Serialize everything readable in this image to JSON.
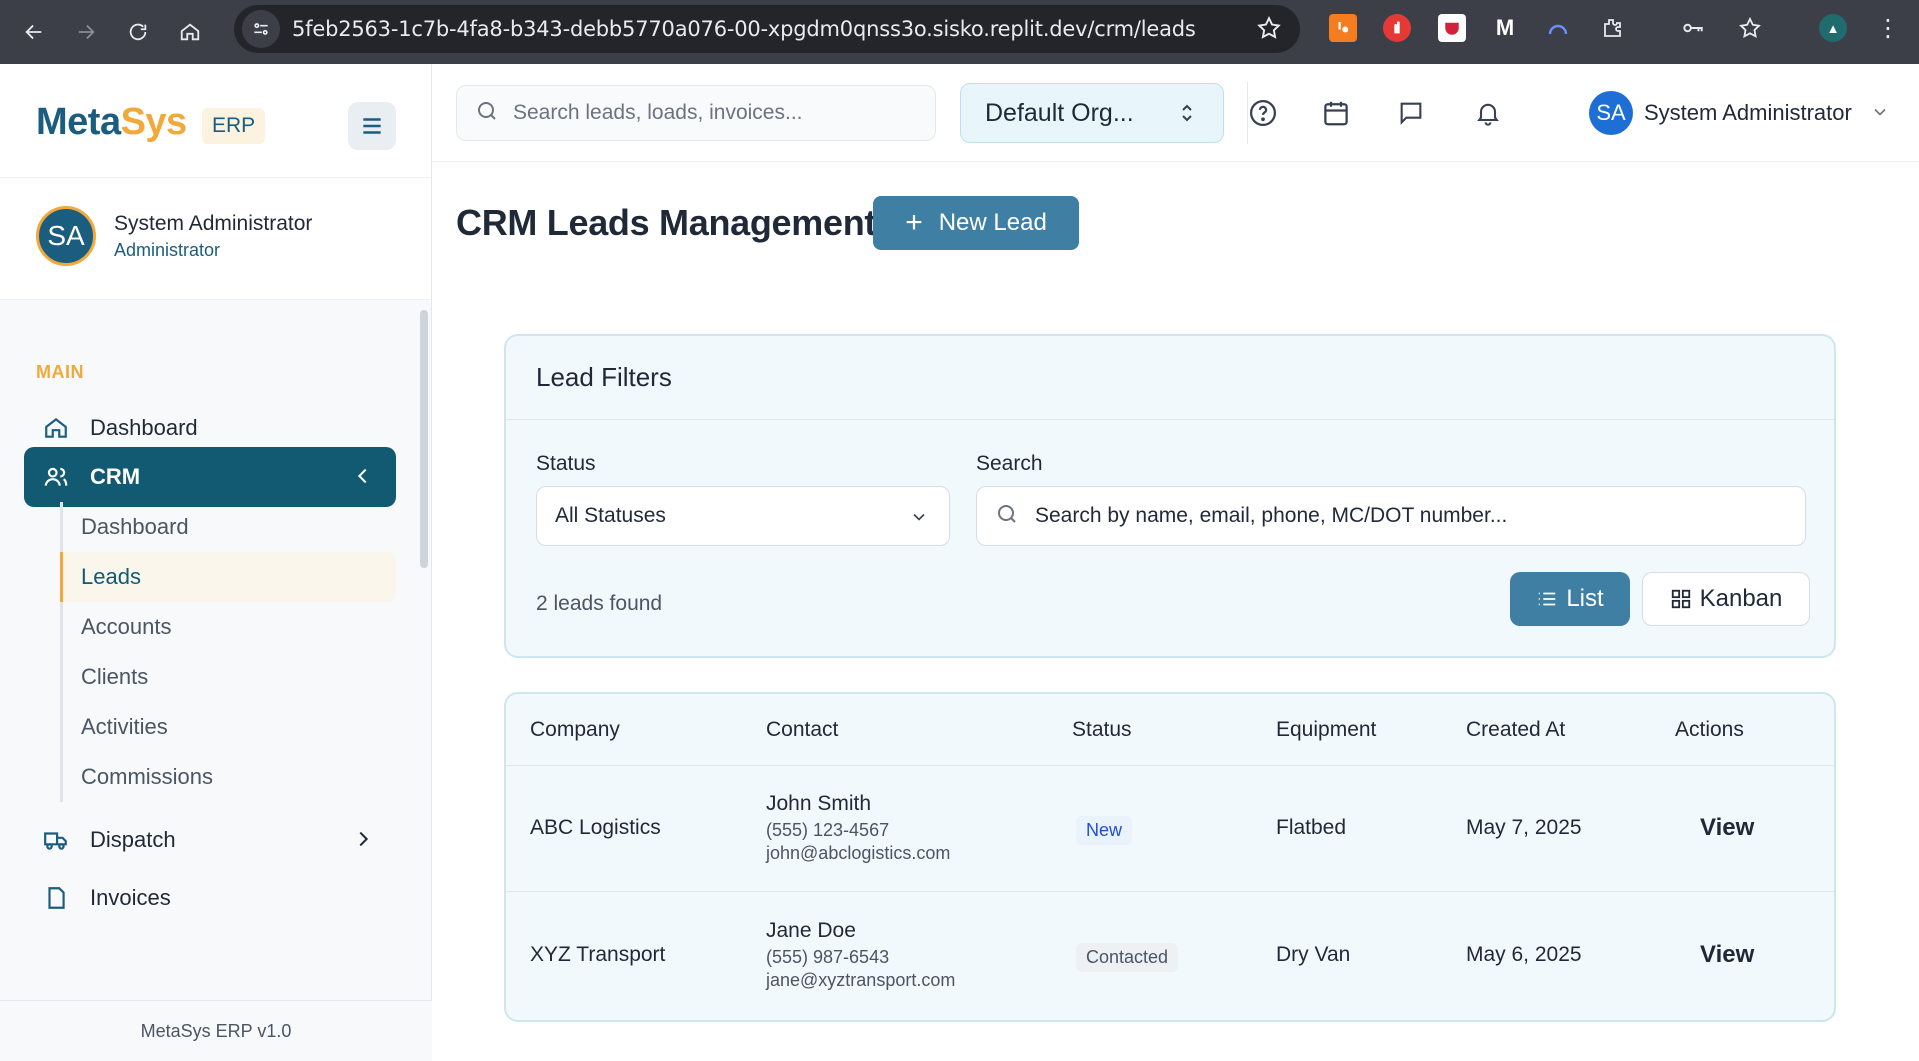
{
  "browser": {
    "url": "5feb2563-1c7b-4fa8-b343-debb5770a076-00-xpgdm0qnss3o.sisko.replit.dev/crm/leads"
  },
  "brand": {
    "meta": "Meta",
    "sys": "Sys",
    "badge": "ERP"
  },
  "user": {
    "initials": "SA",
    "name": "System Administrator",
    "role": "Administrator"
  },
  "sidebar": {
    "section_label": "MAIN",
    "items": [
      {
        "label": "Dashboard"
      },
      {
        "label": "CRM"
      },
      {
        "label": "Dispatch"
      },
      {
        "label": "Invoices"
      }
    ],
    "crm_subitems": [
      {
        "label": "Dashboard"
      },
      {
        "label": "Leads"
      },
      {
        "label": "Accounts"
      },
      {
        "label": "Clients"
      },
      {
        "label": "Activities"
      },
      {
        "label": "Commissions"
      }
    ],
    "footer": "MetaSys ERP v1.0"
  },
  "topbar": {
    "search_placeholder": "Search leads, loads, invoices...",
    "org": "Default Org...",
    "user_name": "System Administrator",
    "user_initials": "SA"
  },
  "page": {
    "title": "CRM Leads Management",
    "new_lead_label": "New Lead"
  },
  "filters": {
    "title": "Lead Filters",
    "status_label": "Status",
    "status_value": "All Statuses",
    "search_label": "Search",
    "search_placeholder": "Search by name, email, phone, MC/DOT number...",
    "found_text": "2 leads found",
    "list_label": "List",
    "kanban_label": "Kanban"
  },
  "table": {
    "headers": [
      "Company",
      "Contact",
      "Status",
      "Equipment",
      "Created At",
      "Actions"
    ],
    "rows": [
      {
        "company": "ABC Logistics",
        "contact_name": "John Smith",
        "phone": "(555) 123-4567",
        "email": "john@abclogistics.com",
        "status": "New",
        "equipment": "Flatbed",
        "created_at": "May 7, 2025",
        "action": "View"
      },
      {
        "company": "XYZ Transport",
        "contact_name": "Jane Doe",
        "phone": "(555) 987-6543",
        "email": "jane@xyztransport.com",
        "status": "Contacted",
        "equipment": "Dry Van",
        "created_at": "May 6, 2025",
        "action": "View"
      }
    ]
  },
  "colors": {
    "primary": "#125a72",
    "accent": "#f2a93b",
    "button": "#3f7fa3"
  }
}
